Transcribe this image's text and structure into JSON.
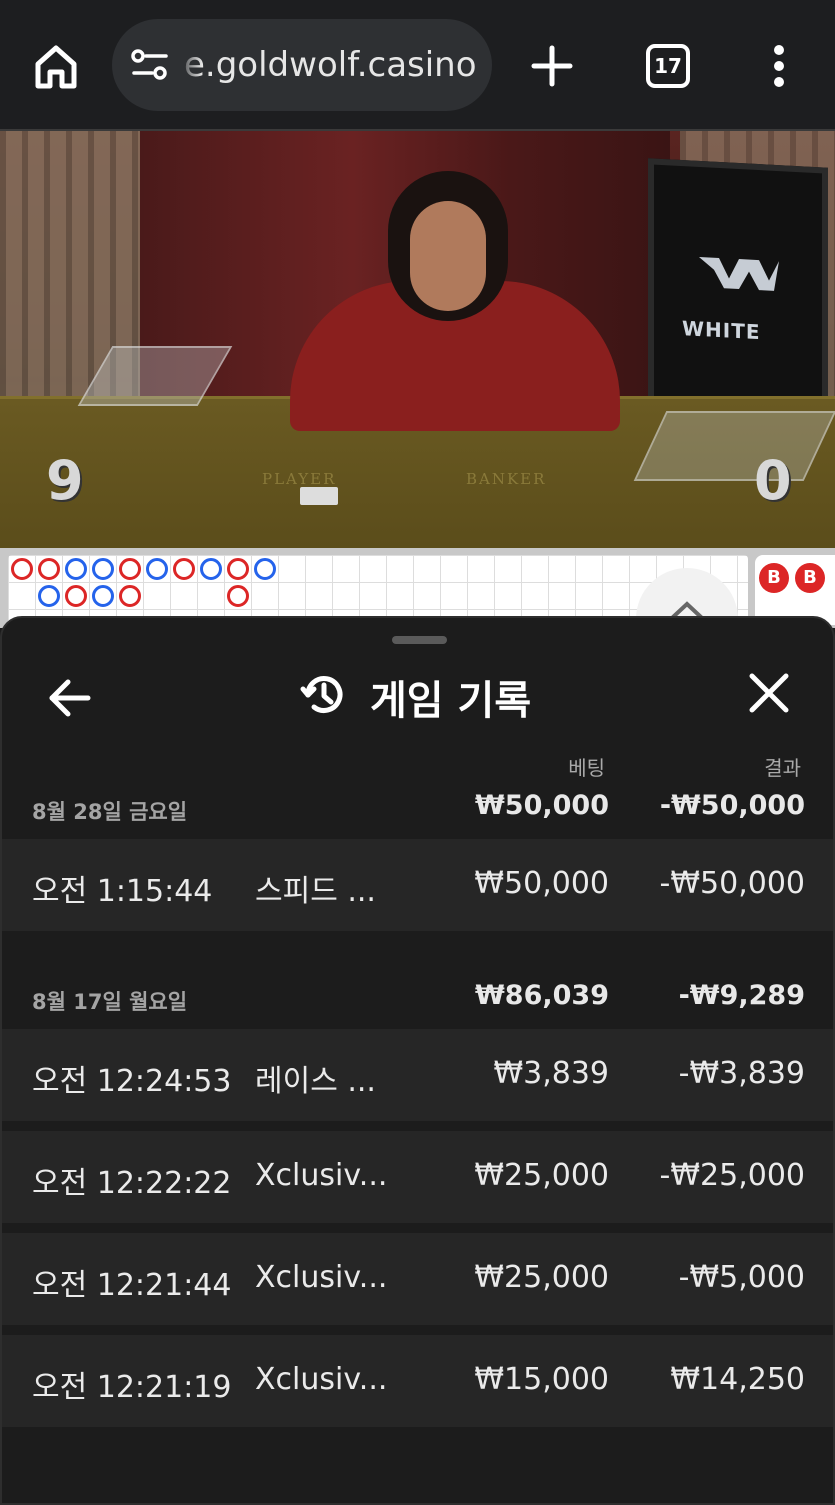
{
  "browser": {
    "url": "e.goldwolf.casino",
    "tab_count": "17"
  },
  "video": {
    "monitor_text": "WHITE",
    "label_player": "PLAYER",
    "label_banker": "BANKER",
    "score_player": "9",
    "score_banker": "0"
  },
  "roadmap": {
    "side_labels": [
      "B",
      "B"
    ]
  },
  "sheet": {
    "title": "게임 기록",
    "col_bet": "베팅",
    "col_result": "결과",
    "groups": [
      {
        "date": "8월 28일 금요일",
        "total_bet": "₩50,000",
        "total_result": "-₩50,000",
        "rows": [
          {
            "time": "오전 1:15:44",
            "game": "스피드 ...",
            "bet": "₩50,000",
            "result": "-₩50,000"
          }
        ]
      },
      {
        "date": "8월 17일 월요일",
        "total_bet": "₩86,039",
        "total_result": "-₩9,289",
        "rows": [
          {
            "time": "오전 12:24:53",
            "game": "레이스 ...",
            "bet": "₩3,839",
            "result": "-₩3,839"
          },
          {
            "time": "오전 12:22:22",
            "game": "Xclusiv...",
            "bet": "₩25,000",
            "result": "-₩25,000"
          },
          {
            "time": "오전 12:21:44",
            "game": "Xclusiv...",
            "bet": "₩25,000",
            "result": "-₩5,000"
          },
          {
            "time": "오전 12:21:19",
            "game": "Xclusiv...",
            "bet": "₩15,000",
            "result": "₩14,250"
          }
        ]
      }
    ]
  },
  "colors": {
    "sheet_bg": "#1c1c1c",
    "row_bg": "#262626",
    "bead_blue": "#2563eb",
    "bead_red": "#dc2626"
  }
}
